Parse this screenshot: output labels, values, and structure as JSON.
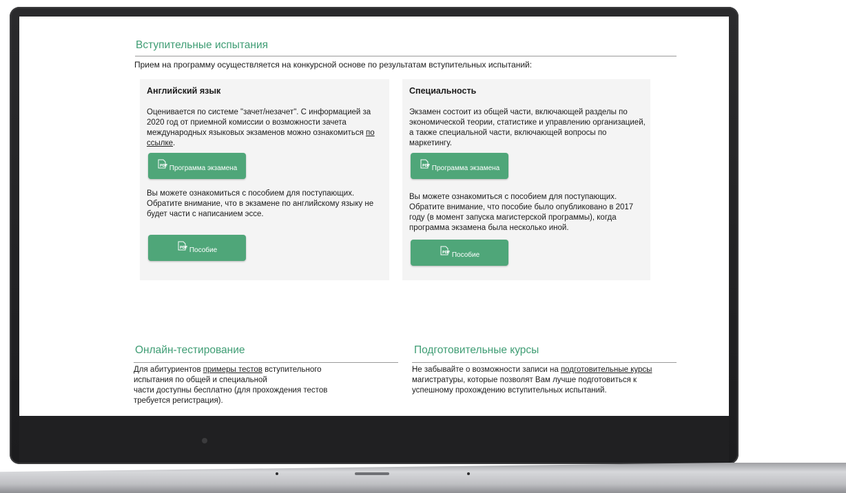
{
  "exams": {
    "title": "Вступительные испытания",
    "intro": "Прием на программу осуществляется на конкурсной основе по результатам вступительных испытаний:",
    "english": {
      "title": "Английский язык",
      "desc_before": "Оценивается по системе \"зачет/незачет\". С информацией за 2020 год от приемной комиссии о возможности зачета международных языковых экзаменов можно ознакомиться ",
      "desc_link": "по ссылке",
      "desc_after": ".",
      "program_button": "Программа экзамена",
      "manual_text": "Вы можете ознакомиться с пособием для поступающих. Обратите внимание, что в экзамене по английскому языку не будет части с написанием эссе.",
      "manual_button": "Пособие"
    },
    "specialty": {
      "title": "Специальность",
      "desc": "Экзамен состоит из общей части, включающей разделы по экономической теории, статистике и управлению организацией, а также специальной части, включающей вопросы по маркетингу.",
      "program_button": "Программа экзамена",
      "manual_text": "Вы можете ознакомиться с пособием для поступающих. Обратите внимание, что пособие было опубликовано в 2017 году (в момент запуска магистерской программы), когда программа экзамена была несколько иной.",
      "manual_button": "Пособие"
    }
  },
  "online": {
    "title": "Онлайн-тестирование",
    "line1_before": "Для абитуриентов ",
    "line1_link": "примеры тестов",
    "line1_after": " вступительного",
    "line2": "испытания по общей и специальной",
    "line3": "части доступны бесплатно (для прохождения тестов",
    "line4": "требуется регистрация)."
  },
  "courses": {
    "title": "Подготовительные курсы",
    "text_before": "Не забывайте о возможности записи на ",
    "text_link": "подготовительные курсы",
    "text_after": " магистратуры, которые позволят Вам лучше подготовиться к успешному прохождению вступительных испытаний."
  },
  "icons": {
    "pdf": "pdf-file-icon"
  },
  "colors": {
    "accent": "#3f9d74",
    "button": "#4fa679",
    "card": "#f4f4f4"
  }
}
